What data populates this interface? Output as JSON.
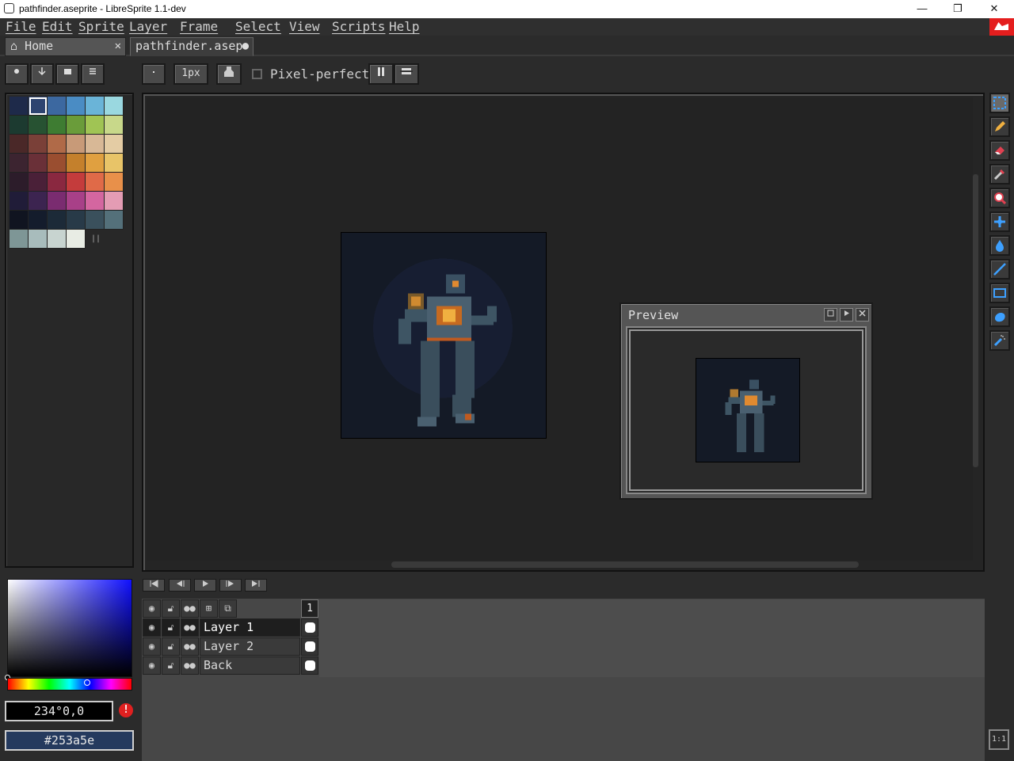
{
  "window": {
    "title": "pathfinder.aseprite - LibreSprite 1.1-dev",
    "minimize": "—",
    "maximize": "❐",
    "close": "✕"
  },
  "menu": [
    "File",
    "Edit",
    "Sprite",
    "Layer",
    "Frame",
    "Select",
    "View",
    "Scripts",
    "Help"
  ],
  "tabs": [
    {
      "label": "Home",
      "close": "✕",
      "icon": "home-icon"
    },
    {
      "label": "pathfinder.asep",
      "modified": "●"
    }
  ],
  "toolbar": {
    "brush_size": "1px",
    "pixel_perfect_label": "Pixel-perfect"
  },
  "palette": {
    "colors": [
      "#1e2a4a",
      "#2e4470",
      "#3c68a0",
      "#4a8cc4",
      "#6ab4d8",
      "#9ad8e0",
      "#1c3a30",
      "#275232",
      "#3e7c32",
      "#6a9c3a",
      "#a0c454",
      "#c8d88a",
      "#4a2828",
      "#7a4038",
      "#b06a48",
      "#c89a78",
      "#d8b896",
      "#e4cca4",
      "#3c2430",
      "#6a3038",
      "#9a4e30",
      "#c4802c",
      "#e0a040",
      "#e8c468",
      "#2c1c2a",
      "#4a2038",
      "#8a2840",
      "#c43c3c",
      "#e06a48",
      "#e8904a",
      "#201c38",
      "#3c2450",
      "#7a2c70",
      "#a84088",
      "#d466a0",
      "#e49cb4",
      "#101420",
      "#141c2c",
      "#1c2a38",
      "#283a48",
      "#3a505c",
      "#54707a",
      "#7e9696",
      "#a8bcbc",
      "#c8d4d0",
      "#e8ece4"
    ],
    "selected_index": 1
  },
  "color": {
    "hsv": "234°0,0",
    "hex": "#253a5e",
    "warning": "!"
  },
  "preview": {
    "title": "Preview"
  },
  "timeline": {
    "frame_number": "1",
    "layers": [
      {
        "name": "Layer 1",
        "active": true
      },
      {
        "name": "Layer 2",
        "active": false
      },
      {
        "name": "Back",
        "active": false
      }
    ]
  },
  "zoom": {
    "label": "1:1"
  }
}
